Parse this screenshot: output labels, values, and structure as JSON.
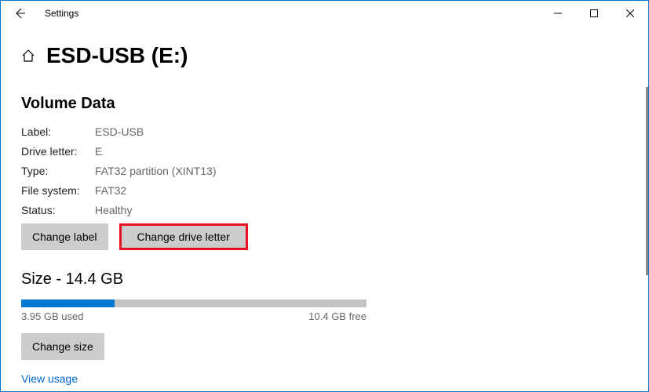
{
  "titlebar": {
    "title": "Settings"
  },
  "page": {
    "title": "ESD-USB (E:)"
  },
  "volume": {
    "heading": "Volume Data",
    "rows": {
      "label_key": "Label:",
      "label_val": "ESD-USB",
      "drive_key": "Drive letter:",
      "drive_val": "E",
      "type_key": "Type:",
      "type_val": "FAT32 partition (XINT13)",
      "fs_key": "File system:",
      "fs_val": "FAT32",
      "status_key": "Status:",
      "status_val": "Healthy"
    },
    "buttons": {
      "change_label": "Change label",
      "change_drive_letter": "Change drive letter"
    }
  },
  "size": {
    "heading": "Size - 14.4 GB",
    "used_text": "3.95 GB used",
    "free_text": "10.4 GB free",
    "used_percent": 27,
    "change_size": "Change size",
    "view_usage": "View usage"
  }
}
